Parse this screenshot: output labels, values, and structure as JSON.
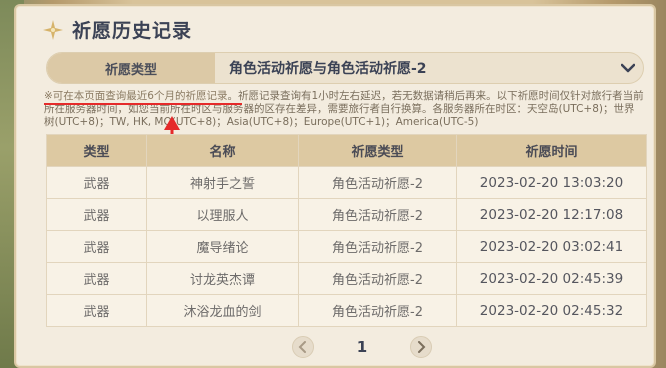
{
  "window": {
    "title": "祈愿历史记录"
  },
  "filter": {
    "label": "祈愿类型",
    "value": "角色活动祈愿与角色活动祈愿-2"
  },
  "notice": {
    "highlight": "※可在本页面查询最近6个月的祈愿记录",
    "rest": "。祈愿记录查询有1小时左右延迟，若无数据请稍后再来。以下祈愿时间仅针对旅行者当前所在服务器时间，如您当前所在时区与服务器的区存在差异，需要旅行者自行换算。各服务器所在时区：天空岛(UTC+8)；世界树(UTC+8)；TW, HK, MO(UTC+8)；Asia(UTC+8)；Europe(UTC+1)；America(UTC-5)"
  },
  "table": {
    "headers": [
      "类型",
      "名称",
      "祈愿类型",
      "祈愿时间"
    ],
    "rows": [
      [
        "武器",
        "神射手之誓",
        "角色活动祈愿-2",
        "2023-02-20 13:03:20"
      ],
      [
        "武器",
        "以理服人",
        "角色活动祈愿-2",
        "2023-02-20 12:17:08"
      ],
      [
        "武器",
        "魔导绪论",
        "角色活动祈愿-2",
        "2023-02-20 03:02:41"
      ],
      [
        "武器",
        "讨龙英杰谭",
        "角色活动祈愿-2",
        "2023-02-20 02:45:39"
      ],
      [
        "武器",
        "沐浴龙血的剑",
        "角色活动祈愿-2",
        "2023-02-20 02:45:32"
      ]
    ]
  },
  "pager": {
    "current_page": "1"
  },
  "colors": {
    "accent_red": "#e52a2a",
    "header_bg": "#ddc9a2",
    "title_text": "#3b4255"
  },
  "icons": {
    "title": "sparkle-star-icon",
    "dropdown": "chevron-down-icon",
    "prev": "chevron-left-icon",
    "next": "chevron-right-icon"
  }
}
